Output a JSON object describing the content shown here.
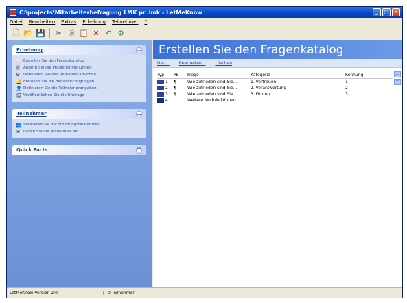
{
  "window": {
    "title": "C:\\projects\\Mitarbeiterbefragung LMK pr..lmk - LetMeKnow"
  },
  "menu": [
    "Datei",
    "Bearbeiten",
    "Extras",
    "Erhebung",
    "Teilnehmer",
    "?"
  ],
  "toolbar": {
    "icons": [
      "new-icon",
      "open-icon",
      "save-icon",
      "cut-icon",
      "copy-icon",
      "paste-icon",
      "delete-icon",
      "undo-icon",
      "settings-icon"
    ]
  },
  "sidebar": {
    "erhebung": {
      "title": "Erhebung",
      "items": [
        {
          "label": "Erstellen Sie den Fragenkatalog",
          "icon": "document-icon"
        },
        {
          "label": "Ändern Sie die Projekteinstellungen",
          "icon": "settings-icon"
        },
        {
          "label": "Definieren Sie das Verhalten am Ende",
          "icon": "behavior-icon"
        },
        {
          "label": "Erstellen Sie die Benachrichtigungen",
          "icon": "notification-icon"
        },
        {
          "label": "Definieren Sie die Teilnehmerangaben",
          "icon": "participant-data-icon"
        },
        {
          "label": "Veröffentlichen Sie die Umfrage",
          "icon": "publish-icon"
        }
      ]
    },
    "teilnehmer": {
      "title": "Teilnehmer",
      "items": [
        {
          "label": "Verwalten Sie die Erhebungsteilnehmer",
          "icon": "manage-users-icon"
        },
        {
          "label": "Laden Sie die Teilnehmer ein",
          "icon": "mail-icon"
        }
      ]
    },
    "quickfacts": {
      "title": "Quick Facts"
    }
  },
  "main": {
    "banner": "Erstellen Sie den Fragenkatalog",
    "actions": [
      "Neu...",
      "Bearbeiten...",
      "Löschen"
    ],
    "columns": [
      "Typ",
      "PE",
      "Frage",
      "Kategorie",
      "Kennung"
    ],
    "rows": [
      {
        "typ": "1",
        "pe": "¶",
        "frage": "Wie zufrieden sind Sie...",
        "kategorie": "1. Vertrauen",
        "kennung": "1"
      },
      {
        "typ": "2",
        "pe": "¶",
        "frage": "Wie zufrieden sind Sie...",
        "kategorie": "2. Verantwortung",
        "kennung": "2"
      },
      {
        "typ": "3",
        "pe": "¶",
        "frage": "Wie zufrieden sind Sie...",
        "kategorie": "3. Führen",
        "kennung": "3"
      },
      {
        "typ": "4",
        "pe": "",
        "frage": "Weitere Module können ...",
        "kategorie": "",
        "kennung": ""
      }
    ]
  },
  "status": {
    "version": "LetMeKnow Version 2.0",
    "participants": "0 Teilnehmer"
  }
}
